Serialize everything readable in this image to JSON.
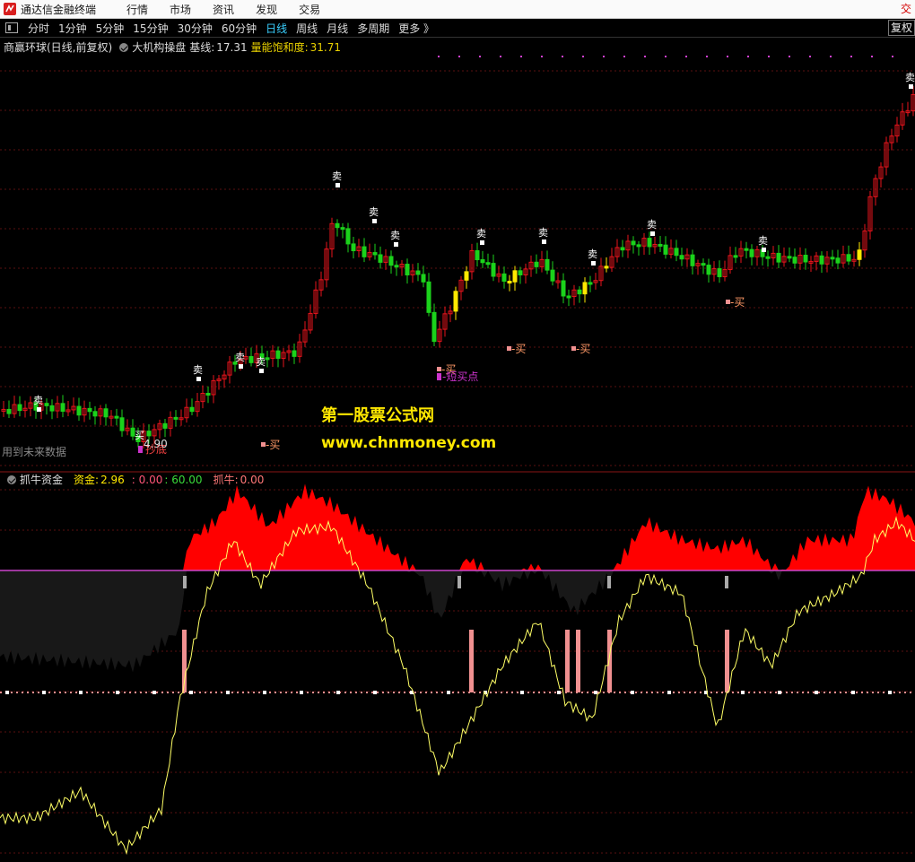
{
  "app": {
    "title": "通达信金融终端",
    "top_right": "交"
  },
  "menu": [
    "行情",
    "市场",
    "资讯",
    "发现",
    "交易"
  ],
  "periods": {
    "items": [
      "分时",
      "1分钟",
      "5分钟",
      "15分钟",
      "30分钟",
      "60分钟",
      "日线",
      "周线",
      "月线",
      "多周期",
      "更多 》"
    ],
    "active": "日线",
    "fuquan": "复权"
  },
  "main_legend": {
    "stock": "商赢环球(日线,前复权)",
    "indicator": "大机构操盘",
    "base_label": "基线:",
    "base_value": "17.31",
    "sat_label": "量能饱和度:",
    "sat_value": "31.71"
  },
  "sub_legend": {
    "indicator": "抓牛资金",
    "fund_label": "资金:",
    "fund_value": "2.96",
    "v2": ": 0.00",
    "v3": ": 60.00",
    "bull_label": "抓牛:",
    "bull_value": "0.00"
  },
  "watermark": {
    "line1": "第一股票公式网",
    "line2": "www.chnmoney.com"
  },
  "note": "用到未来数据",
  "markers": {
    "sell": "卖",
    "buy": "买",
    "buy_tag": "-买",
    "bottom_tag": "抄底",
    "short_buy_tag": "-短买点",
    "low_price": "4.90"
  },
  "colors": {
    "up": "#e8141c",
    "down": "#1bd21b",
    "yellow": "#ffe800",
    "pink": "#f09090",
    "magenta": "#cc33cc",
    "grid": "#5a1010",
    "fund_fill": "#ff0000",
    "black_fill": "#181818"
  }
}
